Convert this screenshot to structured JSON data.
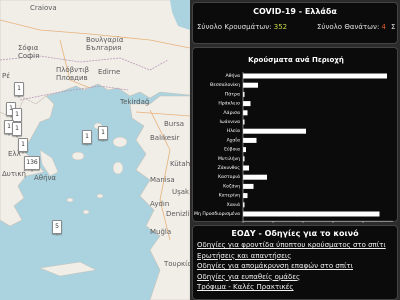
{
  "map": {
    "labels": [
      "Craiova",
      "Σόφια",
      "Софія",
      "Πλόβντιβ",
      "Пловдив",
      "Edirne",
      "Βουλγαρία",
      "България",
      "Tekirdağ",
      "Bursa",
      "Balıkesir",
      "Manisa",
      "Kütahya",
      "Uşak",
      "Aydın",
      "Denizli",
      "Muğla",
      "Τουρκία",
      "Ρέ",
      "Δυτική",
      "Ελλ",
      "Αθήνα"
    ],
    "markers": [
      "1",
      "1",
      "1",
      "1",
      "1",
      "1",
      "1",
      "1",
      "136",
      "5"
    ]
  },
  "summary": {
    "title": "COVID-19 - Ελλάδα",
    "cases_label": "Σύνολο Κρουσμάτων: ",
    "cases_value": "352",
    "deaths_label": "Σύνολο Θανάτων: ",
    "deaths_value": "4",
    "extra_label": "Σ"
  },
  "colors": {
    "accent_green": "#c8d84a",
    "accent_red": "#e05a2a",
    "panel_bg": "#0b0b0b"
  },
  "chart_data": {
    "type": "bar",
    "orientation": "horizontal",
    "title": "Κρούσματα ανά Περιοχή",
    "categories": [
      "Αθήνα",
      "Θεσσαλονίκη",
      "Πάτρα",
      "Ηράκλειο",
      "Λάρισα",
      "Ιωάννινα",
      "Ηλεία",
      "Αχαΐα",
      "Εύβοια",
      "Μυτιλήνη",
      "Ζάκυνθος",
      "Καστοριά",
      "Κοζάνη",
      "Κατερίνη",
      "Χανιά",
      "Μη Προσδιορισμένα"
    ],
    "values": [
      96,
      10,
      1,
      5,
      3,
      1,
      42,
      9,
      2,
      1,
      4,
      16,
      7,
      3,
      1,
      91
    ],
    "xticks": [
      0,
      20,
      40,
      60,
      80
    ],
    "xlim": [
      0,
      100
    ],
    "grid": false
  },
  "guidance": {
    "title": "ΕΟΔΥ - Οδηγίες για το κοινό",
    "links": [
      "Οδηγίες για φροντίδα ύποπτου κρούσματος στο σπίτι",
      "Ερωτήσεις και απαντήσεις",
      "Οδηγίες για απομάκρυνση επαφών στο σπίτι",
      "Οδηγίες για ευπαθείς ομάδες",
      "Τρόφιμα - Καλές Πρακτικές"
    ]
  }
}
